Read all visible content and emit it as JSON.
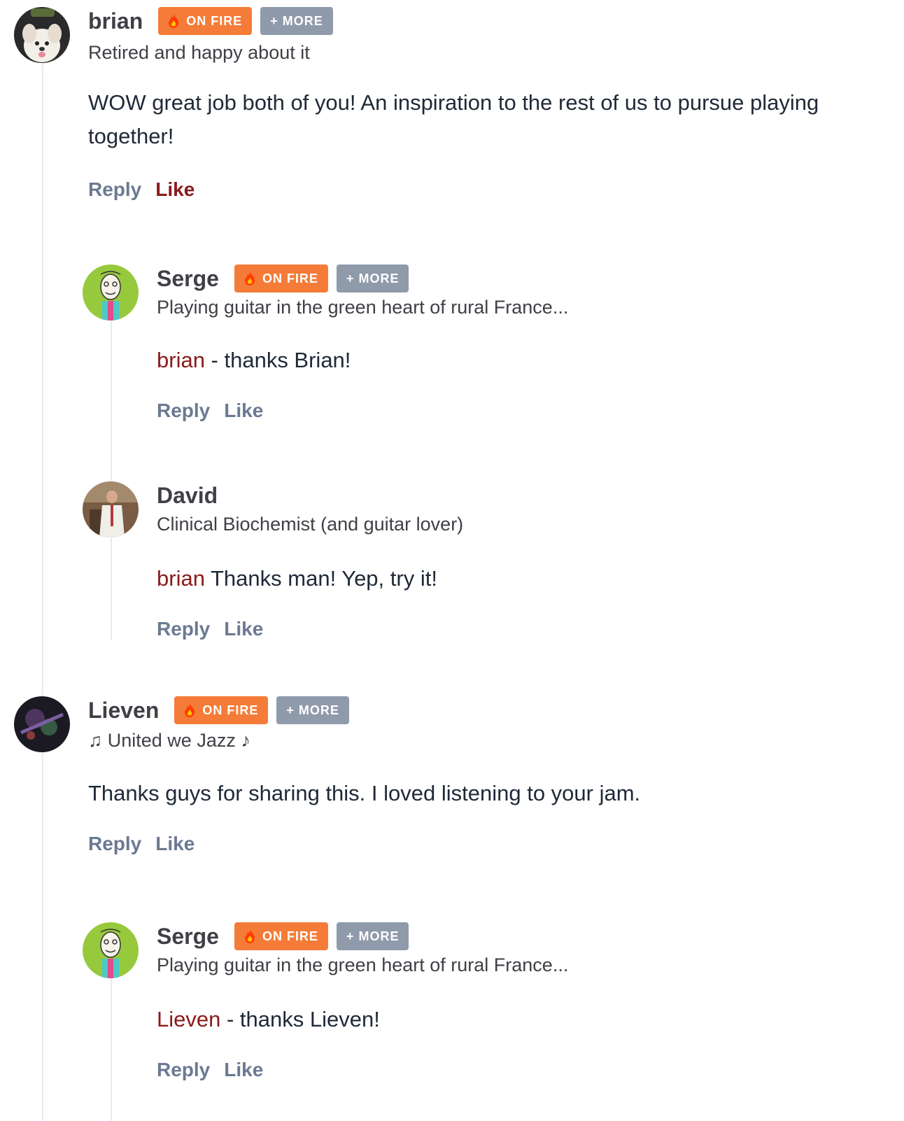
{
  "comments": [
    {
      "author": "brian",
      "badges": {
        "on_fire": "ON FIRE",
        "more": "+ MORE"
      },
      "tagline": "Retired and happy about it",
      "text": "WOW great job both of you! An inspiration to the rest of us to pursue playing together!",
      "actions": {
        "reply": "Reply",
        "like": "Like",
        "liked": true
      }
    },
    {
      "author": "Serge",
      "badges": {
        "on_fire": "ON FIRE",
        "more": "+ MORE"
      },
      "tagline": "Playing guitar in the green heart of rural France...",
      "mention": "brian",
      "text": " - thanks Brian!",
      "actions": {
        "reply": "Reply",
        "like": "Like",
        "liked": false
      }
    },
    {
      "author": "David",
      "tagline": "Clinical Biochemist (and guitar lover)",
      "mention": "brian",
      "text": " Thanks man! Yep, try it!",
      "actions": {
        "reply": "Reply",
        "like": "Like",
        "liked": false
      }
    },
    {
      "author": "Lieven",
      "badges": {
        "on_fire": "ON FIRE",
        "more": "+ MORE"
      },
      "tagline": "♫ United we Jazz ♪",
      "text": "Thanks guys for sharing this. I loved listening to your jam.",
      "actions": {
        "reply": "Reply",
        "like": "Like",
        "liked": false
      }
    },
    {
      "author": "Serge",
      "badges": {
        "on_fire": "ON FIRE",
        "more": "+ MORE"
      },
      "tagline": "Playing guitar in the green heart of rural France...",
      "mention": "Lieven",
      "text": " - thanks Lieven!",
      "actions": {
        "reply": "Reply",
        "like": "Like",
        "liked": false
      }
    }
  ],
  "colors": {
    "fire_badge": "#f47c38",
    "more_badge": "#8f9aab",
    "mention": "#8b1a1a",
    "action": "#6b7a92",
    "thread_line": "#e8ebef"
  }
}
